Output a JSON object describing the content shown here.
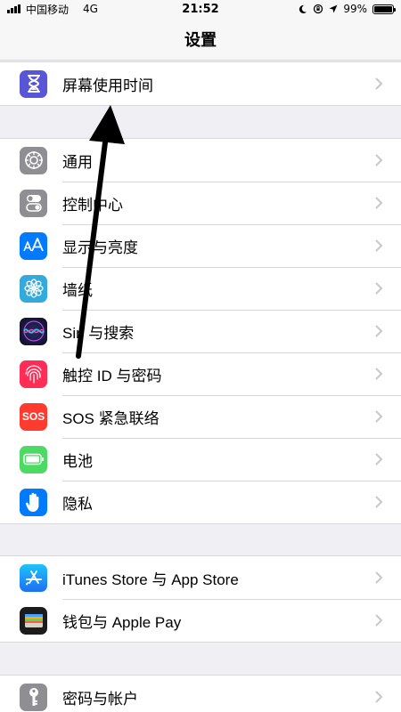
{
  "status_bar": {
    "carrier": "中国移动",
    "network": "4G",
    "time": "21:52",
    "battery": "99%",
    "battery_level": 0.99
  },
  "nav": {
    "title": "设置"
  },
  "groups": [
    {
      "items": [
        {
          "label": "屏幕使用时间",
          "icon": "hourglass-icon",
          "color": "#5856d6"
        }
      ]
    },
    {
      "items": [
        {
          "label": "通用",
          "icon": "gear-icon",
          "color": "#8e8e93"
        },
        {
          "label": "控制中心",
          "icon": "toggle-switches-icon",
          "color": "#8e8e93"
        },
        {
          "label": "显示与亮度",
          "icon": "text-size-icon",
          "color": "#007aff"
        },
        {
          "label": "墙纸",
          "icon": "flower-icon",
          "color": "#34aadc"
        },
        {
          "label": "Siri 与搜索",
          "icon": "siri-icon",
          "color": "#1c1c3c"
        },
        {
          "label": "触控 ID 与密码",
          "icon": "fingerprint-icon",
          "color": "#ff2d55"
        },
        {
          "label": "SOS 紧急联络",
          "icon": "sos-icon",
          "color": "#ff3b30",
          "icon_text": "SOS"
        },
        {
          "label": "电池",
          "icon": "battery-icon",
          "color": "#4cd964"
        },
        {
          "label": "隐私",
          "icon": "hand-icon",
          "color": "#007aff"
        }
      ]
    },
    {
      "items": [
        {
          "label": "iTunes Store 与 App Store",
          "icon": "app-store-icon",
          "color": "#1d8cf7"
        },
        {
          "label": "钱包与 Apple Pay",
          "icon": "wallet-icon",
          "color": "#1c1c1e"
        }
      ]
    },
    {
      "items": [
        {
          "label": "密码与帐户",
          "icon": "key-icon",
          "color": "#8e8e93"
        }
      ]
    }
  ]
}
